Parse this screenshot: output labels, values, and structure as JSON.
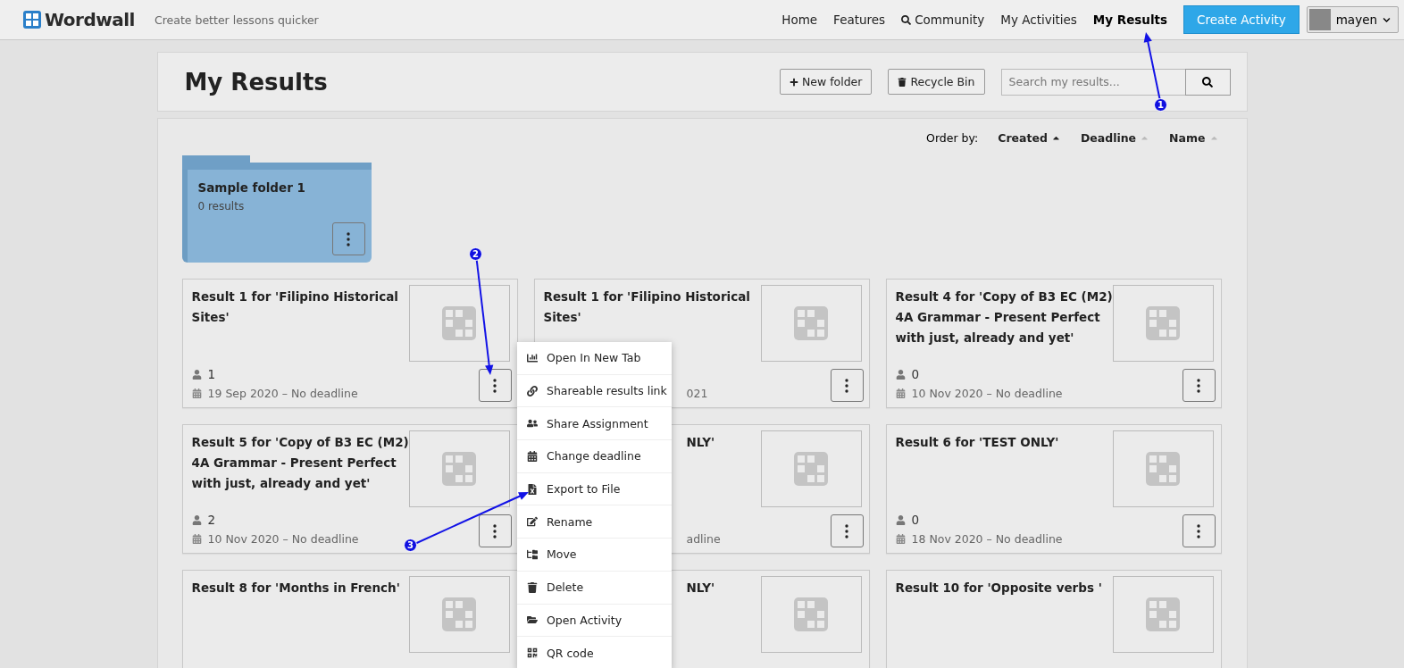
{
  "navbar": {
    "logo": "Wordwall",
    "tagline": "Create better lessons quicker",
    "links": [
      {
        "label": "Home",
        "selected": false
      },
      {
        "label": "Features",
        "selected": false
      },
      {
        "label": "Community",
        "selected": false
      },
      {
        "label": "My Activities",
        "selected": false
      },
      {
        "label": "My Results",
        "selected": true
      }
    ],
    "cta": "Create Activity",
    "user": "mayen"
  },
  "header": {
    "title": "My Results",
    "buttons": [
      {
        "label": "New folder"
      },
      {
        "label": "Recycle Bin"
      }
    ],
    "search": {
      "placeholder": "Search my results..."
    }
  },
  "order_by": {
    "label": "Order by:",
    "options": [
      {
        "label": "Created",
        "selected": true
      },
      {
        "label": "Deadline",
        "selected": false
      },
      {
        "label": "Name",
        "selected": false
      }
    ]
  },
  "folders": [
    {
      "name": "Sample folder 1",
      "count": "0 results"
    }
  ],
  "results": [
    {
      "kind": "full",
      "title": "Result 1 for 'Filipino Historical Sites'",
      "count": "1",
      "date": "19 Sep 2020 – No deadline"
    },
    {
      "kind": "meta_covered",
      "title": "Result 1 for 'Filipino Historical Sites'",
      "date": "021"
    },
    {
      "kind": "full",
      "title": "Result 4 for 'Copy of B3 EC (M2) 4A Grammar - Present Perfect with just, already and yet'",
      "count": "0",
      "date": "10 Nov 2020 – No deadline"
    },
    {
      "kind": "full",
      "title": "Result 5 for 'Copy of B3 EC (M2) 4A Grammar - Present Perfect with just, already and yet'",
      "count": "2",
      "date": "10 Nov 2020 – No deadline"
    },
    {
      "kind": "covered",
      "title": "NLY'",
      "date": "adline"
    },
    {
      "kind": "full",
      "title": "Result 6 for 'TEST ONLY'",
      "count": "0",
      "date": "18 Nov 2020 – No deadline"
    },
    {
      "kind": "full",
      "title": "Result 8 for 'Months in French'"
    },
    {
      "kind": "covered",
      "title": "NLY'"
    },
    {
      "kind": "full",
      "title": "Result 10 for 'Opposite verbs '"
    }
  ],
  "context_menu": [
    {
      "label": "Open In New Tab"
    },
    {
      "label": "Shareable results link"
    },
    {
      "label": "Share Assignment"
    },
    {
      "label": "Change deadline"
    },
    {
      "label": "Export to File"
    },
    {
      "label": "Rename"
    },
    {
      "label": "Move"
    },
    {
      "label": "Delete"
    },
    {
      "label": "Open Activity"
    },
    {
      "label": "QR code"
    }
  ],
  "annotations": [
    {
      "number": "1"
    },
    {
      "number": "2"
    },
    {
      "number": "3"
    }
  ]
}
